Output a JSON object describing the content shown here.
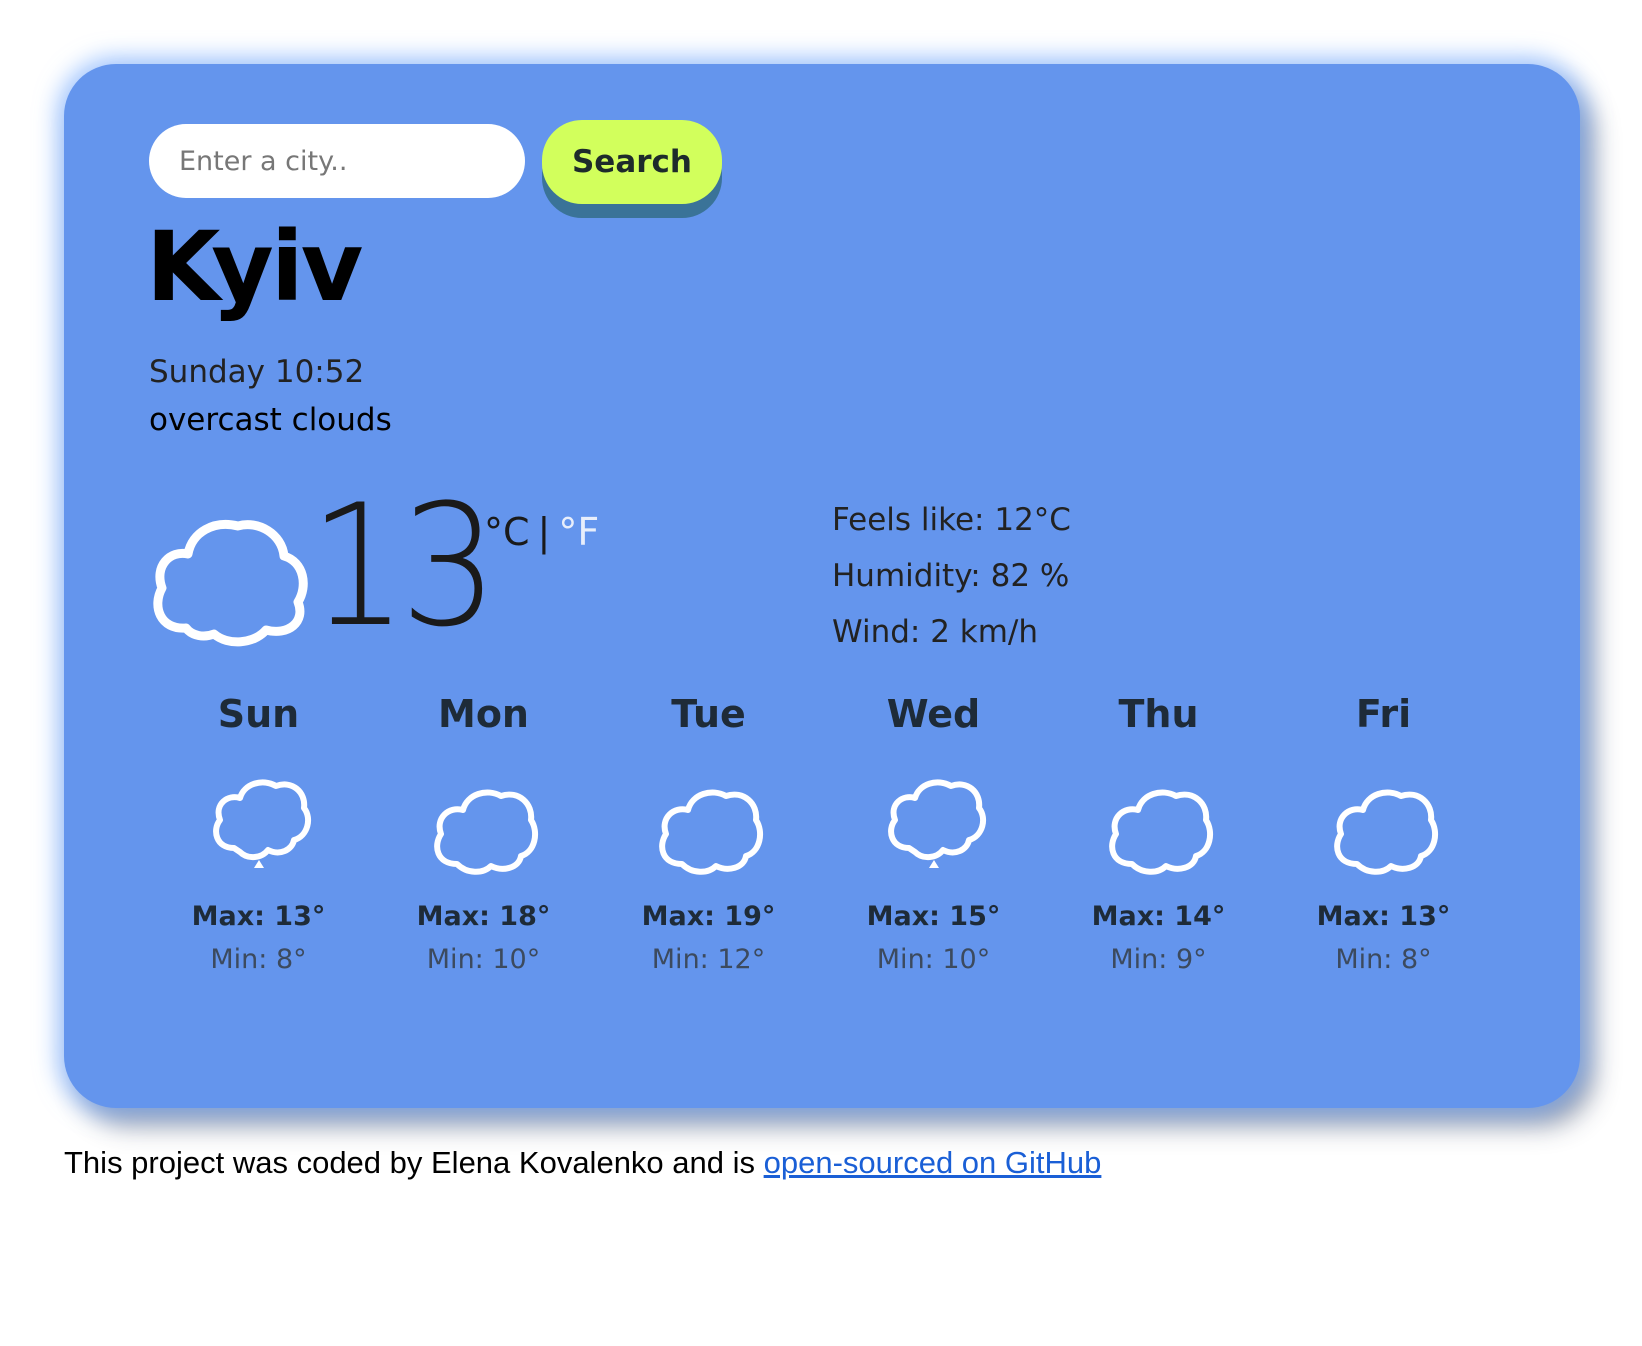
{
  "search": {
    "placeholder": "Enter a city..",
    "button_label": "Search"
  },
  "current": {
    "city": "Kyiv",
    "datetime": "Sunday 10:52",
    "description": "overcast clouds",
    "icon": "cloud-icon",
    "temperature": "13",
    "unit_celsius": "°C",
    "unit_separator": "|",
    "unit_fahrenheit": "°F",
    "feels_like": "Feels like: 12°C",
    "humidity": "Humidity: 82 %",
    "wind": "Wind: 2 km/h"
  },
  "forecast": [
    {
      "day": "Sun",
      "icon": "cloud-rain-icon",
      "max": "Max: 13°",
      "min": "Min: 8°"
    },
    {
      "day": "Mon",
      "icon": "cloud-icon",
      "max": "Max: 18°",
      "min": "Min: 10°"
    },
    {
      "day": "Tue",
      "icon": "cloud-icon",
      "max": "Max: 19°",
      "min": "Min: 12°"
    },
    {
      "day": "Wed",
      "icon": "cloud-rain-icon",
      "max": "Max: 15°",
      "min": "Min: 10°"
    },
    {
      "day": "Thu",
      "icon": "cloud-icon",
      "max": "Max: 14°",
      "min": "Min: 9°"
    },
    {
      "day": "Fri",
      "icon": "cloud-icon",
      "max": "Max: 13°",
      "min": "Min: 8°"
    }
  ],
  "footer": {
    "text": "This project was coded by Elena Kovalenko and is ",
    "link_text": "open-sourced on GitHub"
  },
  "colors": {
    "card_background": "#6495ed",
    "button_background": "#d2ff5c",
    "link": "#1a5fd6"
  }
}
